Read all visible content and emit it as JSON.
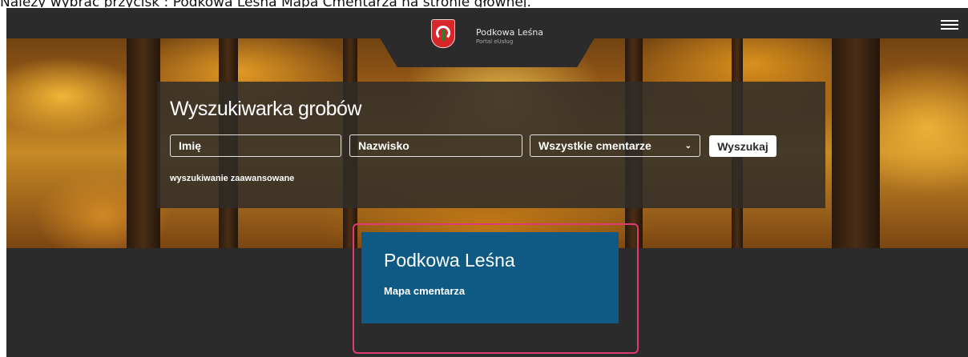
{
  "instruction": {
    "caption": "Należy wybrać przycisk : Podkowa Leśna Mapa Cmentarza na stronie głównej."
  },
  "header": {
    "brand_name": "Podkowa Leśna",
    "brand_sub": "Portal eUsług",
    "logo_icon": "crest-icon",
    "menu_icon": "hamburger-menu-icon"
  },
  "search": {
    "title": "Wyszukiwarka grobów",
    "first_name_placeholder": "Imię",
    "last_name_placeholder": "Nazwisko",
    "cemetery_selected": "Wszystkie cmentarze",
    "search_button": "Wyszukaj",
    "advanced_link": "wyszukiwanie zaawansowane"
  },
  "cemetery_card": {
    "title": "Podkowa Leśna",
    "map_link": "Mapa cmentarza",
    "color": "#0e5a84"
  },
  "highlight_color": "#e03a72"
}
